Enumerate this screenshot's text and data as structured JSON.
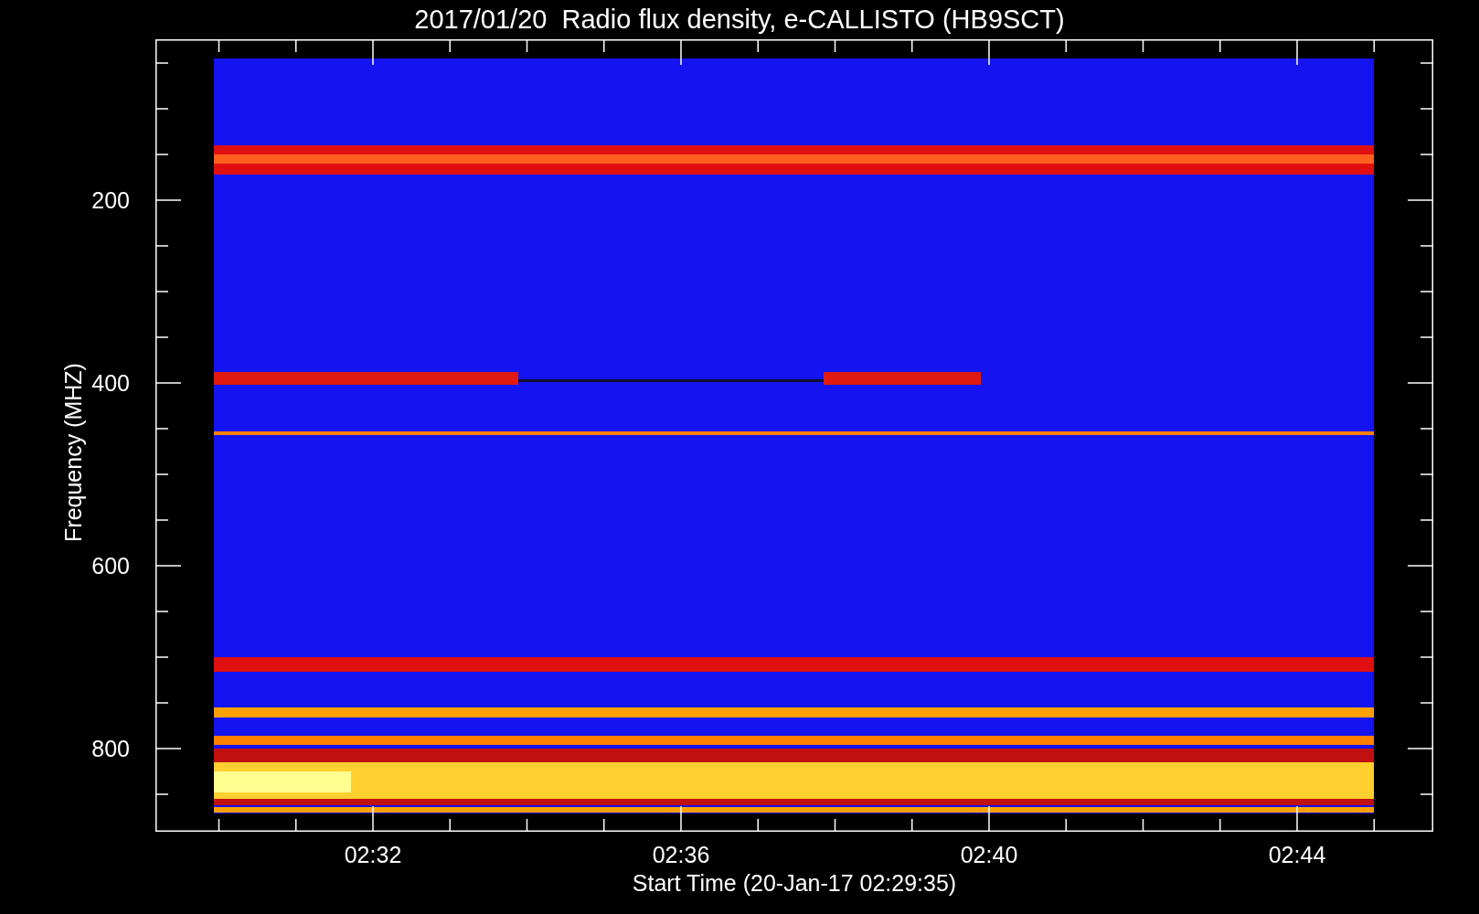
{
  "title": "2017/01/20  Radio flux density, e-CALLISTO (HB9SCT)",
  "y_axis": {
    "label": "Frequency (MHZ)",
    "ticks": [
      "200",
      "400",
      "600",
      "800"
    ]
  },
  "x_axis": {
    "label": "Start Time (20-Jan-17 02:29:35)",
    "ticks": [
      "02:32",
      "02:36",
      "02:40",
      "02:44"
    ]
  }
}
